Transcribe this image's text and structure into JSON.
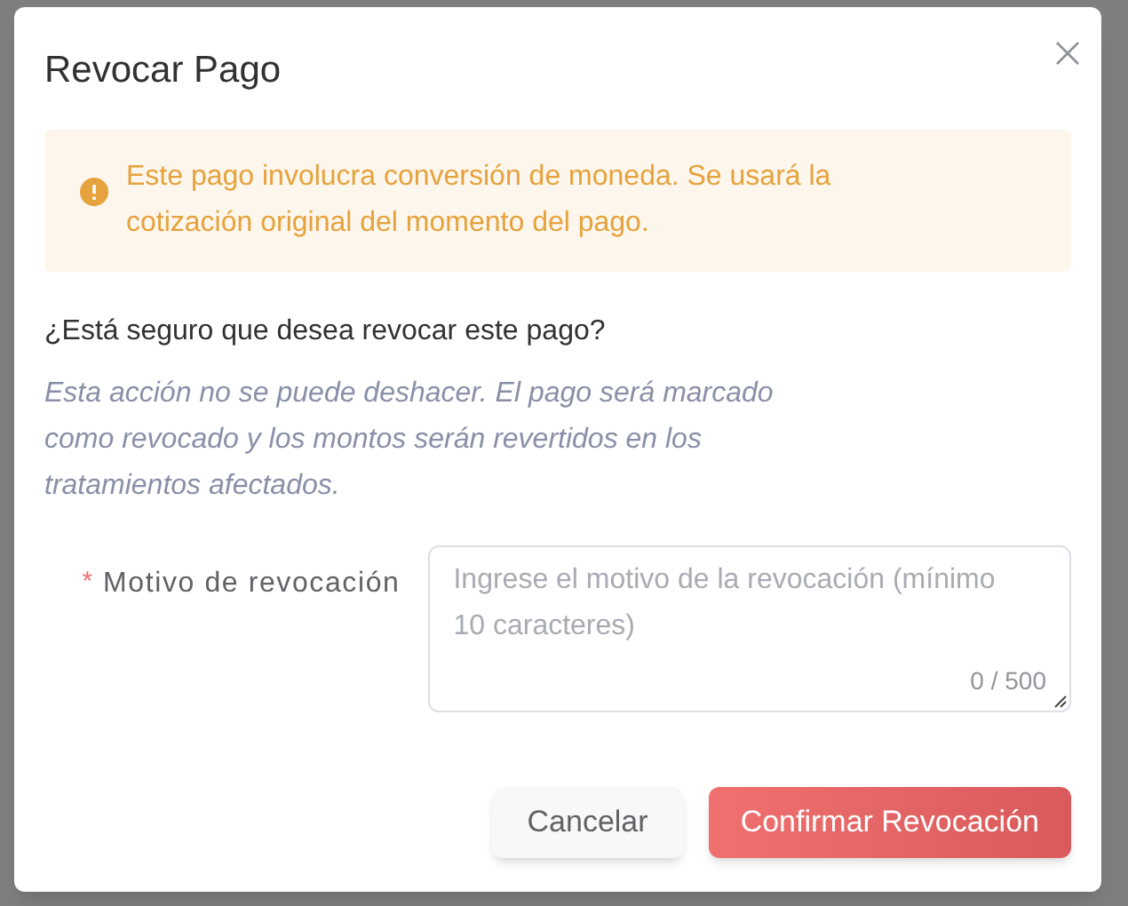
{
  "dialog": {
    "title": "Revocar Pago",
    "warning": "Este pago involucra conversión de moneda. Se usará la cotización original del momento del pago.",
    "question": "¿Está seguro que desea revocar este pago?",
    "note": "Esta acción no se puede deshacer. El pago será marcado como revocado y los montos serán revertidos en los tratamientos afectados.",
    "field": {
      "label": "Motivo de revocación",
      "required_mark": "*",
      "placeholder": "Ingrese el motivo de la revocación (mínimo 10 caracteres)",
      "counter": "0 / 500"
    },
    "buttons": [
      {
        "label": "Cancelar",
        "kind": "secondary"
      },
      {
        "label": "Confirmar Revocación",
        "kind": "danger"
      }
    ]
  }
}
